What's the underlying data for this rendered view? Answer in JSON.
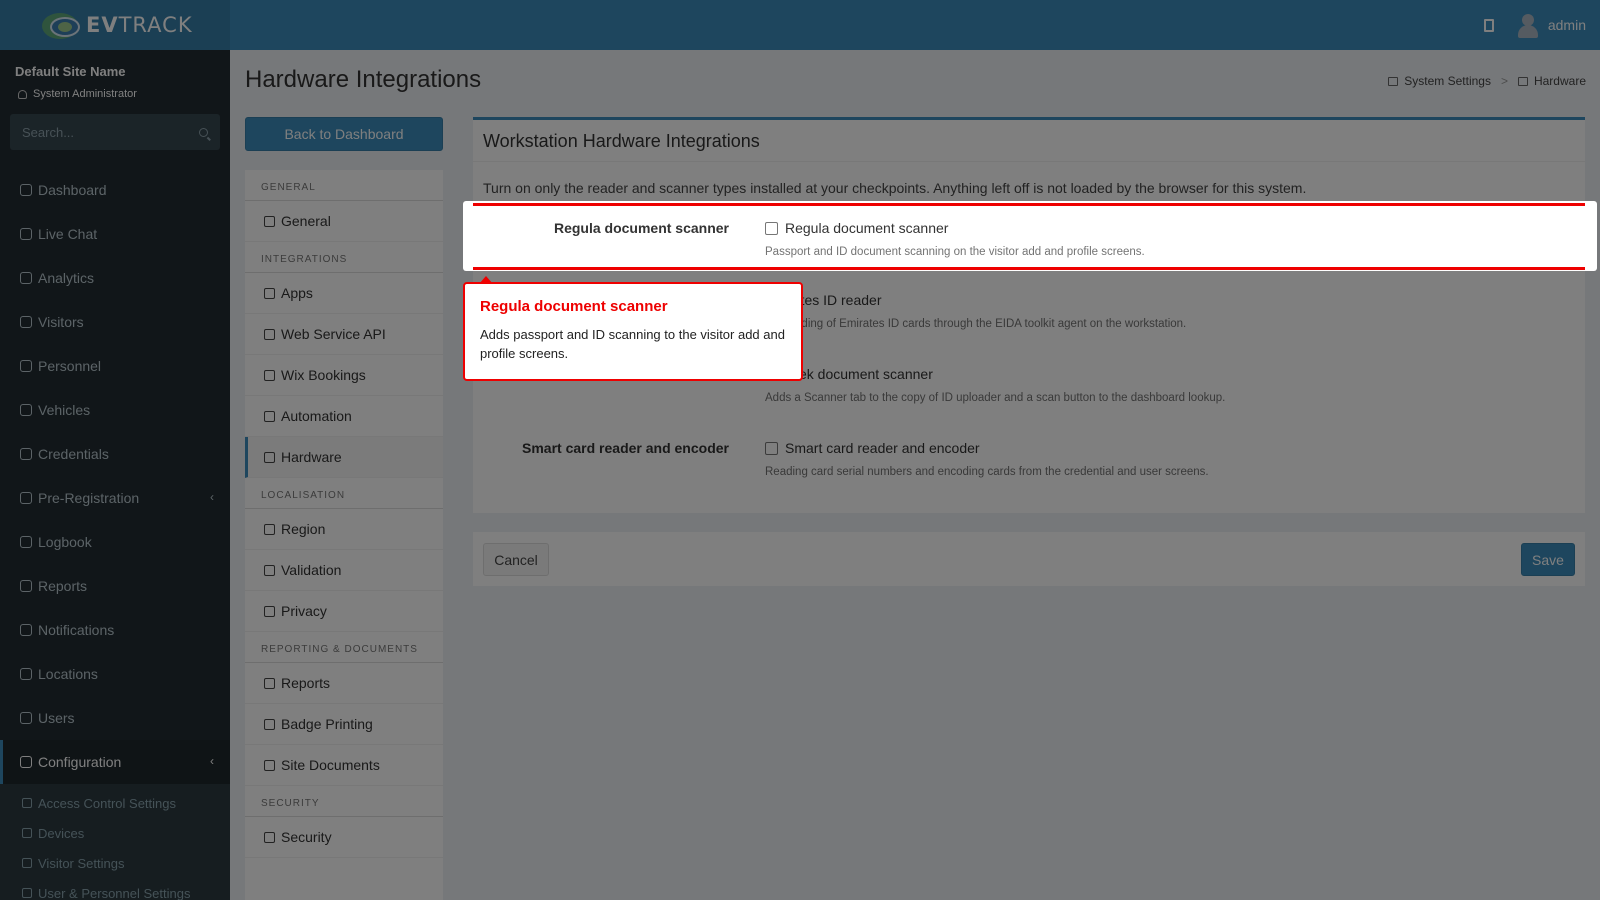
{
  "header": {
    "logo_text_bold": "EV",
    "logo_text_rest": "TRACK",
    "user_name": "admin"
  },
  "sidebar": {
    "site_name": "Default Site Name",
    "role": "System Administrator",
    "search_placeholder": "Search...",
    "items": [
      {
        "label": "Dashboard",
        "icon": "dashboard-icon"
      },
      {
        "label": "Live Chat",
        "icon": "headset-icon"
      },
      {
        "label": "Analytics",
        "icon": "analytics-icon"
      },
      {
        "label": "Visitors",
        "icon": "eye-icon"
      },
      {
        "label": "Personnel",
        "icon": "personnel-icon"
      },
      {
        "label": "Vehicles",
        "icon": "vehicle-icon"
      },
      {
        "label": "Credentials",
        "icon": "credentials-icon"
      },
      {
        "label": "Pre-Registration",
        "icon": "pre-registration-icon"
      },
      {
        "label": "Logbook",
        "icon": "logbook-icon"
      },
      {
        "label": "Reports",
        "icon": "reports-icon"
      },
      {
        "label": "Notifications",
        "icon": "notifications-icon"
      },
      {
        "label": "Locations",
        "icon": "locations-icon"
      },
      {
        "label": "Users",
        "icon": "users-icon"
      },
      {
        "label": "Configuration",
        "icon": "gear-icon"
      }
    ],
    "configuration_subitems": [
      {
        "label": "Access Control Settings",
        "icon": "lock-icon"
      },
      {
        "label": "Devices",
        "icon": "devices-icon"
      },
      {
        "label": "Visitor Settings",
        "icon": "eye-icon"
      },
      {
        "label": "User & Personnel Settings",
        "icon": "users-icon"
      }
    ]
  },
  "page": {
    "title": "Hardware Integrations",
    "breadcrumb": [
      "System Settings",
      ">",
      "Hardware"
    ],
    "back_button": "Back to Dashboard"
  },
  "settings_nav": {
    "sections": [
      {
        "header": "GENERAL",
        "items": [
          "General"
        ]
      },
      {
        "header": "INTEGRATIONS",
        "items": [
          "Apps",
          "Web Service API",
          "Wix Bookings",
          "Automation",
          "Hardware"
        ]
      },
      {
        "header": "LOCALISATION",
        "items": [
          "Region",
          "Validation",
          "Privacy"
        ]
      },
      {
        "header": "REPORTING & DOCUMENTS",
        "items": [
          "Reports",
          "Badge Printing",
          "Site Documents"
        ]
      },
      {
        "header": "SECURITY",
        "items": [
          "Security"
        ]
      }
    ],
    "active_item": "Hardware"
  },
  "panel": {
    "title": "Workstation Hardware Integrations",
    "intro": "Turn on only the reader and scanner types installed at your checkpoints. Anything left off is not loaded by the browser for this system.",
    "rows": [
      {
        "label": "Regula document scanner",
        "checkbox_label": "Regula document scanner",
        "help": "Passport and ID document scanning on the visitor add and profile screens.",
        "checked": false
      },
      {
        "label": "",
        "checkbox_label": "irates ID reader",
        "help": "ard reading of Emirates ID cards through the EIDA toolkit agent on the workstation.",
        "checked": false
      },
      {
        "label": "",
        "checkbox_label": "istek document scanner",
        "help": "Adds a Scanner tab to the copy of ID uploader and a scan button to the dashboard lookup.",
        "checked": false
      },
      {
        "label": "Smart card reader and encoder",
        "checkbox_label": "Smart card reader and encoder",
        "help": "Reading card serial numbers and encoding cards from the credential and user screens.",
        "checked": false
      }
    ]
  },
  "footer": {
    "cancel_label": "Cancel",
    "save_label": "Save"
  },
  "tour_tip": {
    "title": "Regula document scanner",
    "body": "Adds passport and ID scanning to the visitor add and profile screens."
  },
  "colors": {
    "topbar": "#3c8dbc",
    "sidebar": "#222d32",
    "highlight": "#ee0000"
  }
}
